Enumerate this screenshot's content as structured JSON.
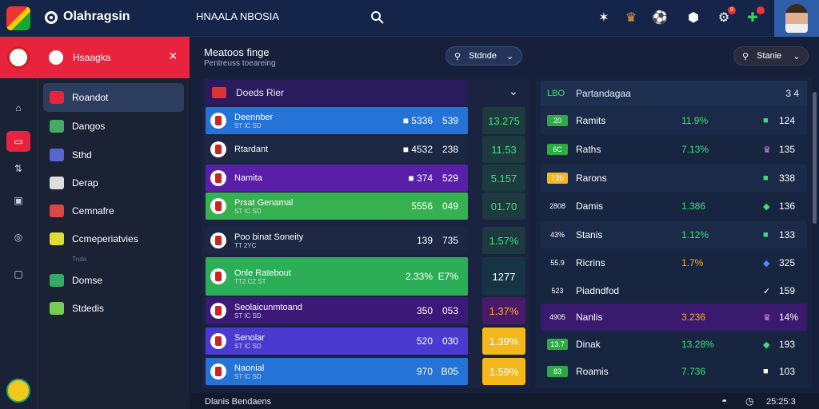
{
  "topbar": {
    "brand": "Olahragsin",
    "subtitle": "HNAALA NBOSIA",
    "icons": [
      "search-icon",
      "star-icon",
      "trophy-icon",
      "soccer-icon",
      "gear-icon",
      "settings-icon",
      "puzzle-icon"
    ],
    "badge_count": "9"
  },
  "sidebar": {
    "header": "Hsaagka",
    "items": [
      {
        "label": "Roandot",
        "color": "#e8233d"
      },
      {
        "label": "Dangos",
        "color": "#4a6"
      },
      {
        "label": "Sthd",
        "color": "#56c"
      },
      {
        "label": "Derap",
        "color": "#ddd"
      },
      {
        "label": "Cemnafre",
        "color": "#d44"
      },
      {
        "label": "Ccmeperiatvies",
        "color": "#dd3"
      },
      {
        "label": "Domse",
        "color": "#3a6"
      },
      {
        "label": "Stdedis",
        "color": "#7c5"
      }
    ],
    "divider_label": "Tnda"
  },
  "main": {
    "title": "Meatoos finge",
    "subtitle": "Pentreuss toeareing",
    "pill_left": "Stdnde",
    "pill_right": "Stanie"
  },
  "left_panel": {
    "header": "Doeds Rier",
    "rows": [
      {
        "name": "Deennber",
        "sub": "ST IC SD",
        "v1": "■ 5336",
        "v2": "539",
        "bg": "#2573d6",
        "box": "13.275",
        "boxbg": "#1d3a3f",
        "boxfg": "#3fe07a"
      },
      {
        "name": "Rtardant",
        "sub": "",
        "v1": "■ 4532",
        "v2": "238",
        "bg": "#1b2743",
        "box": "11.53",
        "boxbg": "#1d3a3f",
        "boxfg": "#3fe07a"
      },
      {
        "name": "Namita",
        "sub": "",
        "v1": "■ 374",
        "v2": "529",
        "bg": "#5a1fa8",
        "box": "5.157",
        "boxbg": "#1d3a3f",
        "boxfg": "#3fe07a"
      },
      {
        "name": "Prsat Genamal",
        "sub": "ST IC SD",
        "v1": "5556",
        "v2": "049",
        "bg": "#36b14f",
        "box": "01.70",
        "boxbg": "#1d3a3f",
        "boxfg": "#3fe07a"
      },
      {
        "name": "Poo binat Soneity",
        "sub": "TT 2YC",
        "v1": "139",
        "v2": "735",
        "bg": "#1b2743",
        "box": "1.57%",
        "boxbg": "#1d3a3f",
        "boxfg": "#3fe07a"
      },
      {
        "name": "Onle Ratebout",
        "sub": "TT2 CZ ST",
        "v1": "2.33%",
        "v2": "E7%",
        "bg": "#2cae58",
        "box": "1277",
        "boxbg": "#173447",
        "boxfg": "#ffffff"
      },
      {
        "name": "Seolaicunmtoand",
        "sub": "ST IC SD",
        "v1": "350",
        "v2": "053",
        "bg": "#3d1977",
        "box": "1.37%",
        "boxbg": "#4a1a6a",
        "boxfg": "#ffb020"
      },
      {
        "name": "Senolar",
        "sub": "ST IC SD",
        "v1": "520",
        "v2": "030",
        "bg": "#4a3ad0",
        "box": "1.39%",
        "boxbg": "#f5b81c",
        "boxfg": "#ffffff"
      },
      {
        "name": "Naonial",
        "sub": "ST IC SD",
        "v1": "970",
        "v2": "B05",
        "bg": "#2573d6",
        "box": "1.59%",
        "boxbg": "#f5b81c",
        "boxfg": "#ffffff"
      }
    ]
  },
  "right_panel": {
    "header_code": "LBO",
    "header": "Partandagaa",
    "header_val": "3 4",
    "rows": [
      {
        "tag": "20",
        "tagbg": "#2eaa44",
        "name": "Ramits",
        "pct": "11.9%",
        "pctc": "#3fe07a",
        "ic": "■",
        "icc": "#3fe07a",
        "num": "124",
        "bg": "#1b2a48"
      },
      {
        "tag": "6C",
        "tagbg": "#2eaa44",
        "name": "Raths",
        "pct": "7.13%",
        "pctc": "#3fe07a",
        "ic": "♛",
        "icc": "#e08ae8",
        "num": "135",
        "bg": "#182540"
      },
      {
        "tag": "720",
        "tagbg": "#f5b81c",
        "name": "Rarons",
        "pct": "",
        "pctc": "#3fe07a",
        "ic": "■",
        "icc": "#3fe07a",
        "num": "338",
        "bg": "#1b2a48"
      },
      {
        "tag": "2808",
        "tagbg": "transparent",
        "name": "Damis",
        "pct": "1.386",
        "pctc": "#3fe07a",
        "ic": "◆",
        "icc": "#3fe07a",
        "num": "136",
        "bg": "#182540"
      },
      {
        "tag": "43%",
        "tagbg": "transparent",
        "name": "Stanis",
        "pct": "1.12%",
        "pctc": "#3fe07a",
        "ic": "■",
        "icc": "#3fe07a",
        "num": "133",
        "bg": "#1b2a48"
      },
      {
        "tag": "55.9",
        "tagbg": "transparent",
        "name": "Ricrins",
        "pct": "1.7%",
        "pctc": "#ffb020",
        "ic": "◆",
        "icc": "#4a8dff",
        "num": "325",
        "bg": "#182540"
      },
      {
        "tag": "523",
        "tagbg": "transparent",
        "name": "Piadndfod",
        "pct": "",
        "pctc": "#3fe07a",
        "ic": "✓",
        "icc": "#ffffff",
        "num": "159",
        "bg": "#182540"
      },
      {
        "tag": "4905",
        "tagbg": "transparent",
        "name": "Nanlis",
        "pct": "3.236",
        "pctc": "#ffb020",
        "ic": "♛",
        "icc": "#e08ae8",
        "num": "14%",
        "bg": "#3a1a6e"
      },
      {
        "tag": "13.7",
        "tagbg": "#2eaa44",
        "name": "Dinak",
        "pct": "13.28%",
        "pctc": "#3fe07a",
        "ic": "◆",
        "icc": "#3fe07a",
        "num": "193",
        "bg": "#182540"
      },
      {
        "tag": "83",
        "tagbg": "#2eaa44",
        "name": "Roamis",
        "pct": "7.736",
        "pctc": "#3fe07a",
        "ic": "■",
        "icc": "#ffffff",
        "num": "103",
        "bg": "#182540"
      }
    ]
  },
  "footer": {
    "left": "Dlanis Bendaens",
    "time": "25:25:3"
  }
}
